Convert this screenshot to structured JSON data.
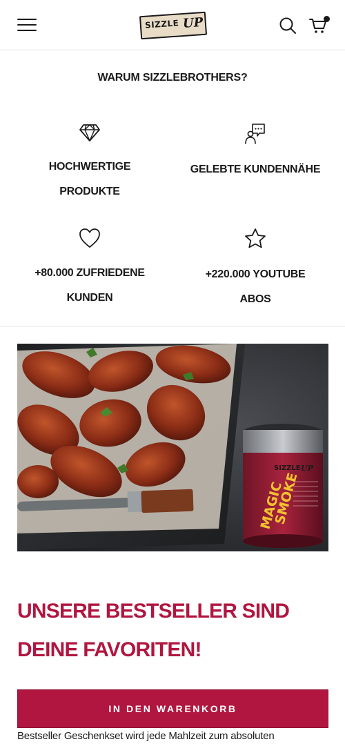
{
  "header": {
    "logo_text": "SIZZLE",
    "logo_script": "UP",
    "menu_icon": "hamburger-menu-icon",
    "search_icon": "search-icon",
    "cart_icon": "cart-icon"
  },
  "why": {
    "title": "WARUM SIZZLEBROTHERS?",
    "features": [
      {
        "icon": "diamond-icon",
        "label_line1": "HOCHWERTIGE",
        "label_line2": "PRODUKTE"
      },
      {
        "icon": "chat-support-icon",
        "label_line1": "GELEBTE KUNDENNÄHE",
        "label_line2": ""
      },
      {
        "icon": "heart-icon",
        "label_line1": "+80.000 ZUFRIEDENE",
        "label_line2": "KUNDEN"
      },
      {
        "icon": "star-icon",
        "label_line1": "+220.000 YOUTUBE",
        "label_line2": "ABOS"
      }
    ]
  },
  "hero": {
    "product_brand": "SIZZLE",
    "product_brand_script": "UP",
    "product_name_line1": "MAGIC",
    "product_name_line2": "SMOKE"
  },
  "bestseller": {
    "title_line1": "UNSERE BESTSELLER SIND",
    "title_line2": "DEINE FAVORITEN!",
    "body": "Bestseller Geschenkset wird jede Mahlzeit zum absoluten"
  },
  "cta": {
    "label": "IN DEN WARENKORB"
  },
  "colors": {
    "accent": "#b0163f",
    "text": "#1a1a1a",
    "divider": "#e2e2e2"
  }
}
